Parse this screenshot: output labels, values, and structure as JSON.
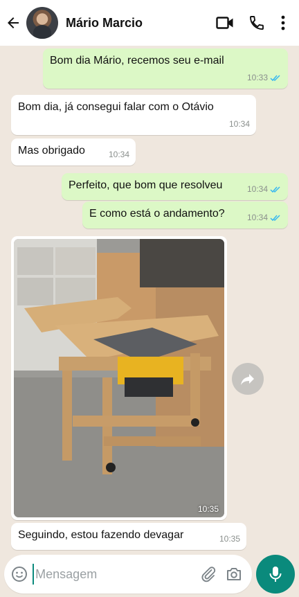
{
  "header": {
    "contact_name": "Mário Marcio",
    "icons": [
      "back-arrow-icon",
      "video-call-icon",
      "phone-icon",
      "more-vert-icon"
    ]
  },
  "messages": [
    {
      "direction": "out",
      "text": "Bom dia Mário, recemos seu e-mail",
      "time": "10:33",
      "status": "read"
    },
    {
      "direction": "in",
      "text": "Bom dia, já consegui falar com o Otávio",
      "time": "10:34"
    },
    {
      "direction": "in",
      "text": "Mas obrigado",
      "time": "10:34"
    },
    {
      "direction": "out",
      "text": "Perfeito, que bom que resolveu",
      "time": "10:34",
      "status": "read"
    },
    {
      "direction": "out",
      "text": "E como está o andamento?",
      "time": "10:34",
      "status": "read"
    },
    {
      "direction": "in",
      "type": "image",
      "image_desc": "workbench-photo",
      "time": "10:35"
    },
    {
      "direction": "in",
      "text": "Seguindo, estou fazendo devagar",
      "time": "10:35"
    }
  ],
  "input": {
    "placeholder": "Mensagem",
    "value": ""
  },
  "colors": {
    "chat_bg": "#efe7de",
    "out_bubble": "#dcf8c6",
    "in_bubble": "#ffffff",
    "accent": "#0a8a7c",
    "read_tick": "#34b7f1"
  }
}
